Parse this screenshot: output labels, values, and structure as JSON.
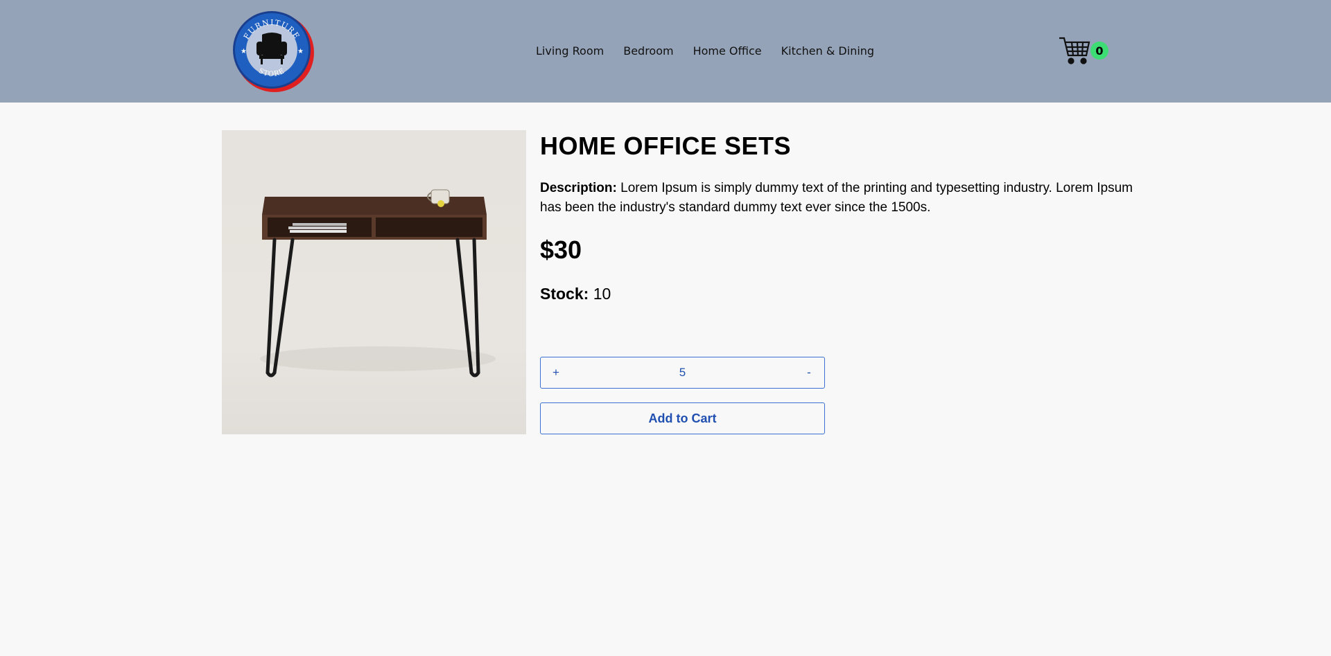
{
  "logo": {
    "top_text": "FURNITURE",
    "bottom_text": "STORE",
    "icon": "armchair-icon",
    "ring_color": "#e02020",
    "badge_color": "#1f5fbf"
  },
  "nav": {
    "items": [
      "Living Room",
      "Bedroom",
      "Home Office",
      "Kitchen & Dining"
    ]
  },
  "cart": {
    "icon": "shopping-cart-icon",
    "count": "0",
    "badge_color": "#3ddc74"
  },
  "product": {
    "image": "desk-photo",
    "title": "HOME OFFICE SETS",
    "description_label": "Description:",
    "description": "Lorem Ipsum is simply dummy text of the printing and typesetting industry. Lorem Ipsum has been the industry's standard dummy text ever since the 1500s.",
    "price": "$30",
    "stock_label": "Stock:",
    "stock": "10"
  },
  "quantity": {
    "increment_label": "+",
    "value": "5",
    "decrement_label": "-"
  },
  "add_to_cart_label": "Add to Cart",
  "colors": {
    "header_bg": "#95a3b8",
    "accent": "#1f4fb0"
  }
}
